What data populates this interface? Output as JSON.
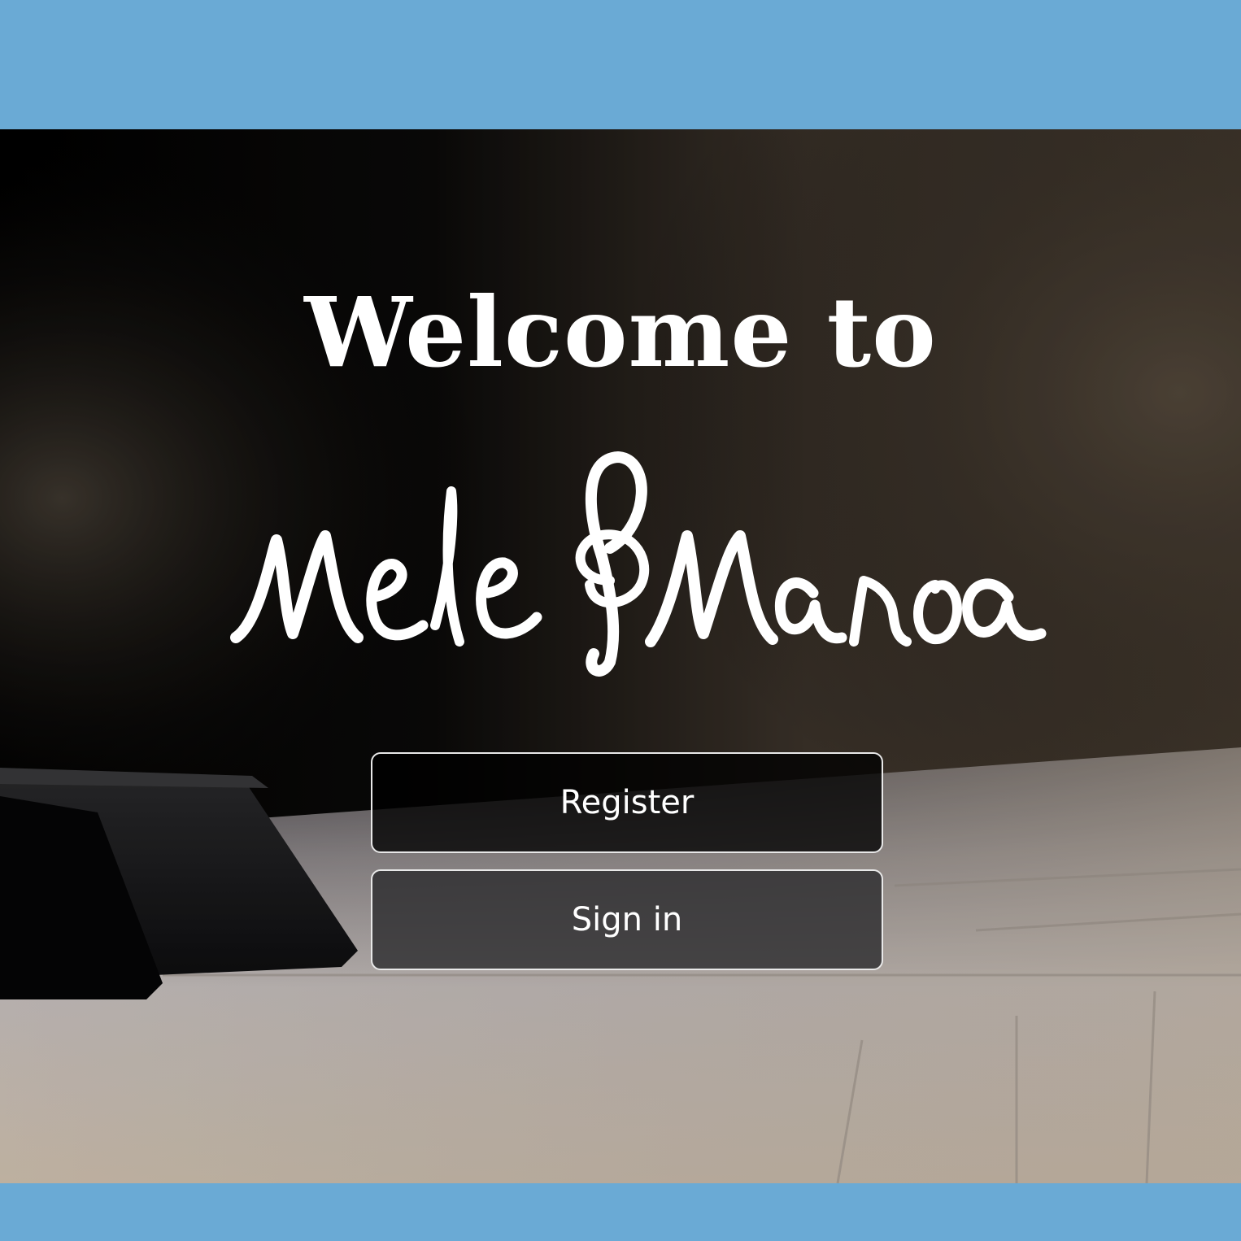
{
  "header": {
    "bar_color": "#6aaad5"
  },
  "hero": {
    "background_image": "piano-keys-photo",
    "welcome_text": "Welcome to",
    "logo": {
      "text": "Mele&Manoa",
      "icon": "treble-clef-icon"
    }
  },
  "actions": {
    "register_label": "Register",
    "signin_label": "Sign in"
  },
  "footer": {
    "bar_color": "#6aaad5"
  }
}
